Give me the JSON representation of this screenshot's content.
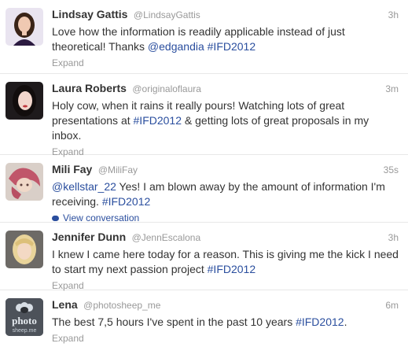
{
  "tweets": [
    {
      "name": "Lindsay Gattis",
      "handle": "@LindsayGattis",
      "time": "3h",
      "text_parts": [
        "Love how the information is readily applicable instead of just theoretical! Thanks ",
        "@edgandia",
        " ",
        "#IFD2012"
      ],
      "action": "Expand",
      "avatar": "woman-dark-hair-avatar"
    },
    {
      "name": "Laura Roberts",
      "handle": "@originaloflaura",
      "time": "3m",
      "text_parts": [
        "Holy cow, when it rains it really pours! Watching lots of great presentations at ",
        "#IFD2012",
        " & getting lots of great proposals in my inbox."
      ],
      "action": "Expand",
      "avatar": "woman-portrait-avatar"
    },
    {
      "name": "Mili Fay",
      "handle": "@MiliFay",
      "time": "35s",
      "text_parts": [
        "@kellstar_22",
        " Yes! I am blown away by the amount of information I'm receiving. ",
        "#IFD2012"
      ],
      "action": "View conversation",
      "avatar": "illustrated-character-avatar"
    },
    {
      "name": "Jennifer Dunn",
      "handle": "@JennEscalona",
      "time": "3h",
      "text_parts": [
        "I knew I came here today for a reason. This is giving me the kick I need to start my next passion project ",
        "#IFD2012"
      ],
      "action": "Expand",
      "avatar": "woman-blonde-avatar"
    },
    {
      "name": "Lena",
      "handle": "@photosheep_me",
      "time": "6m",
      "text_parts": [
        "The best 7,5 hours I've spent in the past 10 years ",
        "#IFD2012",
        "."
      ],
      "action": "Expand",
      "avatar": "photosheep-logo-avatar",
      "avatar_text": [
        "photo",
        "sheep.me"
      ]
    }
  ],
  "colors": {
    "link": "#2a4e9e",
    "muted": "#999999",
    "text": "#333333"
  }
}
